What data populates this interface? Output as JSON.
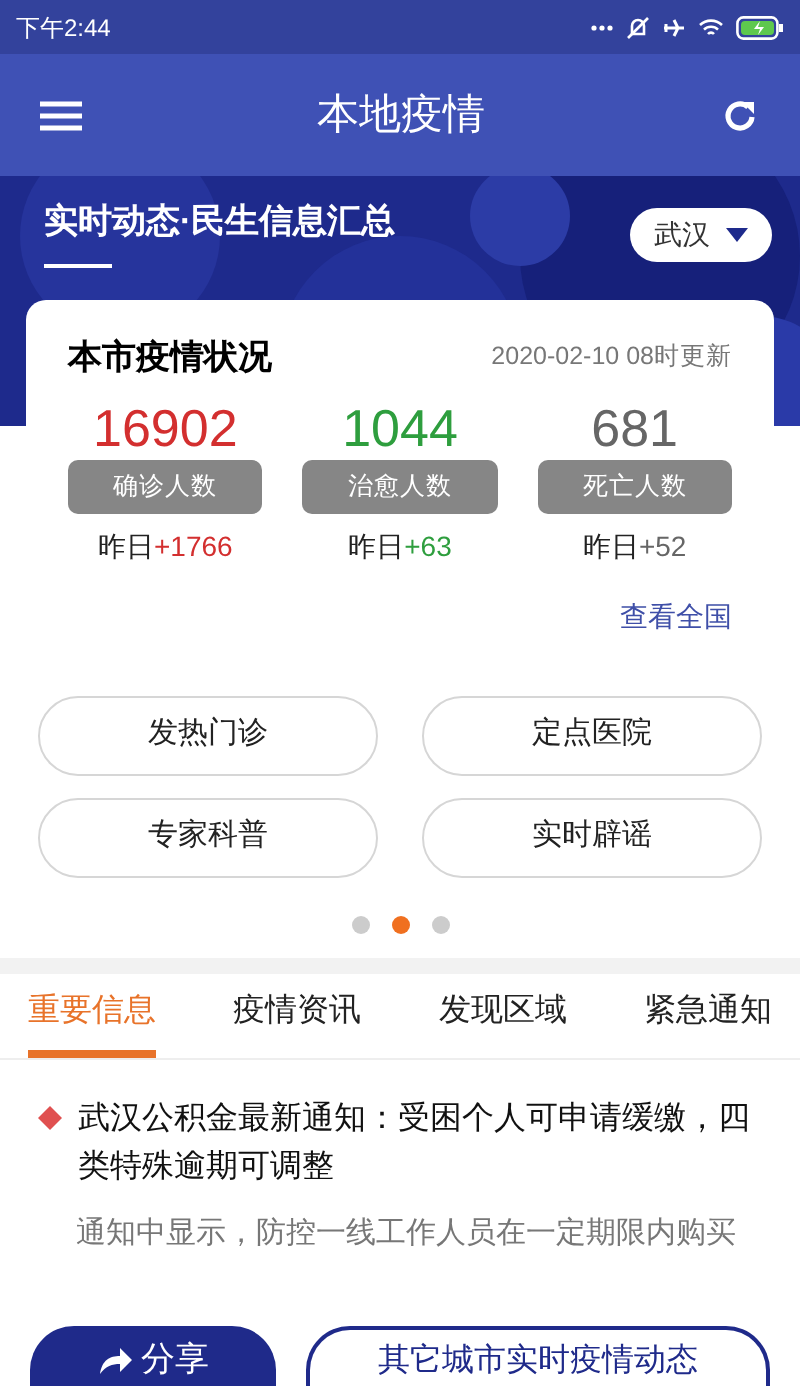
{
  "status_bar": {
    "time": "下午2:44",
    "battery_charging": true
  },
  "header": {
    "title": "本地疫情"
  },
  "banner": {
    "title": "实时动态·民生信息汇总",
    "city": "武汉"
  },
  "stats_card": {
    "title": "本市疫情状况",
    "updated": "2020-02-10 08时更新",
    "stats": [
      {
        "value": "16902",
        "label": "确诊人数",
        "yesterday_label": "昨日",
        "delta": "+1766",
        "color": "#d32f2f"
      },
      {
        "value": "1044",
        "label": "治愈人数",
        "yesterday_label": "昨日",
        "delta": "+63",
        "color": "#2e9e3e"
      },
      {
        "value": "681",
        "label": "死亡人数",
        "yesterday_label": "昨日",
        "delta": "+52",
        "color": "#666666"
      }
    ],
    "link": "查看全国"
  },
  "quick_links": [
    "发热门诊",
    "定点医院",
    "专家科普",
    "实时辟谣"
  ],
  "pager": [
    {
      "selected": false
    },
    {
      "selected": true
    },
    {
      "selected": false
    }
  ],
  "tabs": [
    {
      "label": "重要信息",
      "selected": true
    },
    {
      "label": "疫情资讯",
      "selected": false
    },
    {
      "label": "发现区域",
      "selected": false
    },
    {
      "label": "紧急通知",
      "selected": false
    }
  ],
  "article": {
    "title": "武汉公积金最新通知：受困个人可申请缓缴，四类特殊逾期可调整",
    "summary": "通知中显示，防控一线工作人员在一定期限内购买"
  },
  "bottom_bar": {
    "share": "分享",
    "other_cities": "其它城市实时疫情动态"
  }
}
